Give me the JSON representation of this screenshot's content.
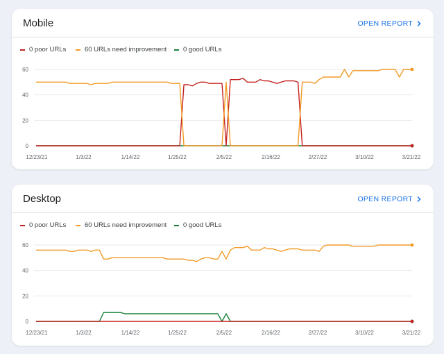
{
  "reports": [
    {
      "title": "Mobile",
      "open_report": "OPEN REPORT",
      "legend": [
        {
          "label": "0 poor URLs",
          "color": "#c5221f"
        },
        {
          "label": "60 URLs need improvement",
          "color": "#f29b26"
        },
        {
          "label": "0 good URLs",
          "color": "#188038"
        }
      ]
    },
    {
      "title": "Desktop",
      "open_report": "OPEN REPORT",
      "legend": [
        {
          "label": "0 poor URLs",
          "color": "#c5221f"
        },
        {
          "label": "60 URLs need improvement",
          "color": "#f29b26"
        },
        {
          "label": "0 good URLs",
          "color": "#188038"
        }
      ]
    }
  ],
  "chart_data": [
    {
      "type": "line",
      "x_ticks": [
        "12/23/21",
        "1/3/22",
        "1/14/22",
        "1/25/22",
        "2/5/22",
        "2/16/22",
        "2/27/22",
        "3/10/22",
        "3/21/22"
      ],
      "y_ticks": [
        0,
        20,
        40,
        60
      ],
      "ylim": [
        0,
        60
      ],
      "series": [
        {
          "name": "0 poor URLs",
          "color": "#c5221f",
          "values": [
            0,
            0,
            0,
            0,
            0,
            0,
            0,
            0,
            0,
            0,
            0,
            0,
            0,
            0,
            0,
            0,
            0,
            0,
            0,
            0,
            0,
            0,
            0,
            0,
            0,
            0,
            0,
            0,
            0,
            0,
            0,
            0,
            0,
            0,
            0,
            48,
            48,
            47,
            49,
            50,
            50,
            49,
            49,
            49,
            49,
            0,
            52,
            52,
            52,
            53,
            50,
            50,
            50,
            52,
            51,
            51,
            50,
            49,
            50,
            51,
            51,
            51,
            50,
            0,
            0,
            0,
            0,
            0,
            0,
            0,
            0,
            0,
            0,
            0,
            0,
            0,
            0,
            0,
            0,
            0,
            0,
            0,
            0,
            0,
            0,
            0,
            0,
            0,
            0,
            0
          ]
        },
        {
          "name": "60 URLs need improvement",
          "color": "#f29b26",
          "values": [
            50,
            50,
            50,
            50,
            50,
            50,
            50,
            50,
            49,
            49,
            49,
            49,
            49,
            48,
            49,
            49,
            49,
            49,
            50,
            50,
            50,
            50,
            50,
            50,
            50,
            50,
            50,
            50,
            50,
            50,
            50,
            50,
            49,
            49,
            49,
            0,
            0,
            0,
            0,
            0,
            0,
            0,
            0,
            0,
            0,
            50,
            0,
            0,
            0,
            0,
            0,
            0,
            0,
            0,
            0,
            0,
            0,
            0,
            0,
            0,
            0,
            0,
            0,
            50,
            50,
            50,
            49,
            52,
            54,
            54,
            54,
            54,
            54,
            60,
            54,
            59,
            59,
            59,
            59,
            59,
            59,
            59,
            60,
            60,
            60,
            60,
            54,
            60,
            60,
            60
          ]
        },
        {
          "name": "0 good URLs",
          "color": "#188038",
          "values": [
            0,
            0,
            0,
            0,
            0,
            0,
            0,
            0,
            0,
            0,
            0,
            0,
            0,
            0,
            0,
            0,
            0,
            0,
            0,
            0,
            0,
            0,
            0,
            0,
            0,
            0,
            0,
            0,
            0,
            0,
            0,
            0,
            0,
            0,
            0,
            0,
            0,
            0,
            0,
            0,
            0,
            0,
            0,
            0,
            0,
            0,
            0,
            0,
            0,
            0,
            0,
            0,
            0,
            0,
            0,
            0,
            0,
            0,
            0,
            0,
            0,
            0,
            0,
            0,
            0,
            0,
            0,
            0,
            0,
            0,
            0,
            0,
            0,
            0,
            0,
            0,
            0,
            0,
            0,
            0,
            0,
            0,
            0,
            0,
            0,
            0,
            0,
            0,
            0,
            0
          ]
        }
      ]
    },
    {
      "type": "line",
      "x_ticks": [
        "12/23/21",
        "1/3/22",
        "1/14/22",
        "1/25/22",
        "2/5/22",
        "2/16/22",
        "2/27/22",
        "3/10/22",
        "3/21/22"
      ],
      "y_ticks": [
        0,
        20,
        40,
        60
      ],
      "ylim": [
        0,
        60
      ],
      "series": [
        {
          "name": "0 poor URLs",
          "color": "#c5221f",
          "values": [
            0,
            0,
            0,
            0,
            0,
            0,
            0,
            0,
            0,
            0,
            0,
            0,
            0,
            0,
            0,
            0,
            0,
            0,
            0,
            0,
            0,
            0,
            0,
            0,
            0,
            0,
            0,
            0,
            0,
            0,
            0,
            0,
            0,
            0,
            0,
            0,
            0,
            0,
            0,
            0,
            0,
            0,
            0,
            0,
            0,
            0,
            0,
            0,
            0,
            0,
            0,
            0,
            0,
            0,
            0,
            0,
            0,
            0,
            0,
            0,
            0,
            0,
            0,
            0,
            0,
            0,
            0,
            0,
            0,
            0,
            0,
            0,
            0,
            0,
            0,
            0,
            0,
            0,
            0,
            0,
            0,
            0,
            0,
            0,
            0,
            0,
            0,
            0,
            0,
            0
          ]
        },
        {
          "name": "60 URLs need improvement",
          "color": "#f29b26",
          "values": [
            56,
            56,
            56,
            56,
            56,
            56,
            56,
            56,
            55,
            55,
            56,
            56,
            56,
            55,
            56,
            56,
            49,
            49,
            50,
            50,
            50,
            50,
            50,
            50,
            50,
            50,
            50,
            50,
            50,
            50,
            50,
            49,
            49,
            49,
            49,
            49,
            48,
            48,
            47,
            49,
            50,
            50,
            49,
            49,
            55,
            49,
            56,
            58,
            58,
            58,
            59,
            56,
            56,
            56,
            58,
            57,
            57,
            56,
            55,
            56,
            57,
            57,
            57,
            56,
            56,
            56,
            56,
            55,
            59,
            60,
            60,
            60,
            60,
            60,
            60,
            59,
            59,
            59,
            59,
            59,
            59,
            60,
            60,
            60,
            60,
            60,
            60,
            60,
            60,
            60
          ]
        },
        {
          "name": "0 good URLs",
          "color": "#188038",
          "values": [
            0,
            0,
            0,
            0,
            0,
            0,
            0,
            0,
            0,
            0,
            0,
            0,
            0,
            0,
            0,
            0,
            7,
            7,
            7,
            7,
            7,
            6,
            6,
            6,
            6,
            6,
            6,
            6,
            6,
            6,
            6,
            6,
            6,
            6,
            6,
            6,
            6,
            6,
            6,
            6,
            6,
            6,
            6,
            6,
            0,
            6,
            0,
            0,
            0,
            0,
            0,
            0,
            0,
            0,
            0,
            0,
            0,
            0,
            0,
            0,
            0,
            0,
            0,
            0,
            0,
            0,
            0,
            0,
            0,
            0,
            0,
            0,
            0,
            0,
            0,
            0,
            0,
            0,
            0,
            0,
            0,
            0,
            0,
            0,
            0,
            0,
            0,
            0,
            0,
            0
          ]
        }
      ]
    }
  ]
}
